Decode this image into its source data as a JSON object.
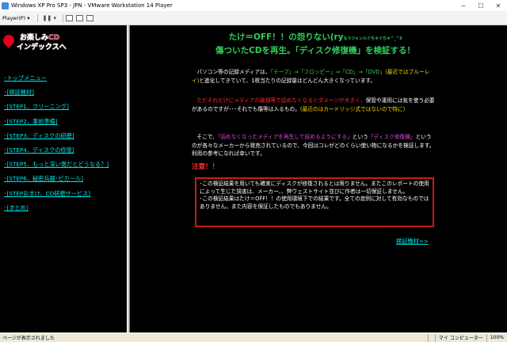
{
  "window": {
    "title": "Windows XP Pro SP3 - JPN - VMware Workstation 14 Player",
    "minimize": "─",
    "maximize": "☐",
    "close": "✕"
  },
  "toolbar": {
    "player_menu": "Player(P) ▾",
    "pause_button": "❚❚ ▾"
  },
  "sidebar": {
    "logo_line1": "お楽しみCD",
    "logo_line2": "インデックスへ",
    "items": [
      "･トップメニュー",
      "･[検証機材]",
      "･[STEP1．クリーニング]",
      "･[STEP2．事前準備]",
      "･[STEP3．ディスクの研磨]",
      "･[STEP4．ディスクの修復]",
      "･[STEP5．もっと深い傷だとどうなる？]",
      "･[STEP6．秘密兵器･ピカール]",
      "･[STEPおまけ．CD研磨サービス]",
      "･[まとめ]"
    ]
  },
  "main": {
    "heading_line1": "たけ＝OFF！！の怨りない(ry",
    "heading_small": "もうジャンルぐちゃぐちゃ^_^3",
    "heading_line2": "傷ついたCDを再生。「ディスク修復機」を検証する！",
    "p1_a": "パソコン等の記録メディアは、",
    "p1_b": "「テープ」⇒「フロッピー」⇒「CD」⇒「DVD」",
    "p1_c": "(最近ではブルーレイ)",
    "p1_d": "と進化してきていて、1枚当たりの記録量はどんどん大きくなっています。",
    "p2_a": "ただそれだけにメディアの破損等で読めなくなるとダメージが大きく、",
    "p2_b": "保管や運用には気を使う必要があるのですが･･･それでも傷等は入るもの。",
    "p2_c": "(最近のはカードリッジ式ではないので特に)",
    "p3_a": "そこで、",
    "p3_b": "「読めなくなったメディアを再生して読めるようにする」",
    "p3_c": "という",
    "p3_d": "「ディスク修復機」",
    "p3_e": "というのが各々なメーカーから発売されているので、今回はコレがどのくらい使い物になるかを検証します。利用の参考になれば幸いです。",
    "warning_title": "注意！！",
    "warning_text_1": "･この検証結果を用いても確実にディスクが修復されるとは限りません。またこのレポートの使用によって生じた損害は、メーカー、、弊ウェストサイト並びに作者は一切保証しません。",
    "warning_text_2": "･この検証結果はたけ＝OFF！！の使用環境下での結果です。全ての症例に対して有効なものではありません。また内容を保証したものでもありません。",
    "next_link": "検証機材>>"
  },
  "statusbar": {
    "left": "ページが表示されました",
    "zone": "マイ コンピューター",
    "zoom": "100%"
  },
  "colors": {
    "heading": "#2fd05a",
    "link": "#00e5e5",
    "warning": "#ff2a2a",
    "yellow": "#ffd200",
    "magenta": "#d84ad8"
  }
}
